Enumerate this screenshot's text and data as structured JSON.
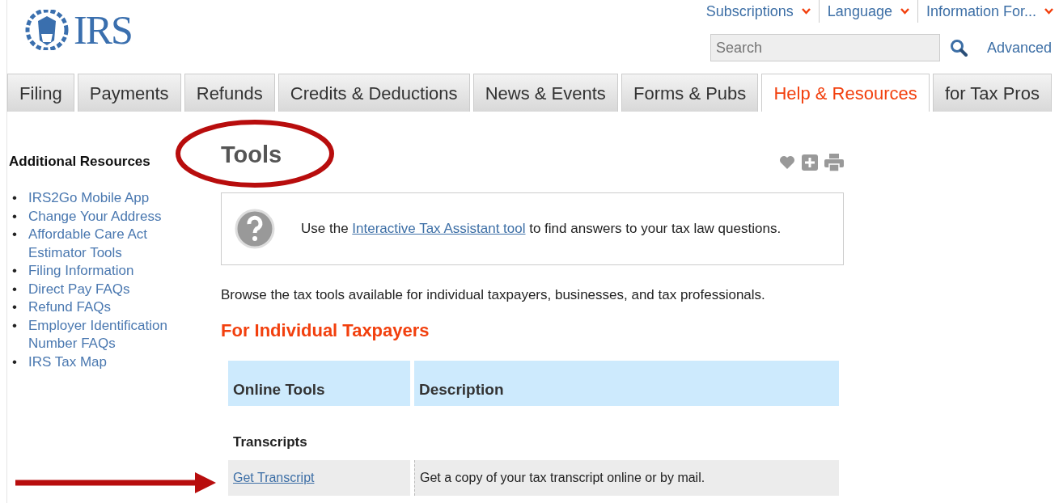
{
  "header": {
    "logo_text": "IRS",
    "top_links": [
      {
        "label": "Subscriptions"
      },
      {
        "label": "Language"
      },
      {
        "label": "Information For..."
      }
    ],
    "search": {
      "placeholder": "Search"
    },
    "advanced_link": "Advanced"
  },
  "tabs": [
    {
      "label": "Filing",
      "selected": false
    },
    {
      "label": "Payments",
      "selected": false
    },
    {
      "label": "Refunds",
      "selected": false
    },
    {
      "label": "Credits & Deductions",
      "selected": false
    },
    {
      "label": "News & Events",
      "selected": false
    },
    {
      "label": "Forms & Pubs",
      "selected": false
    },
    {
      "label": "Help & Resources",
      "selected": true
    },
    {
      "label": "for Tax Pros",
      "selected": false
    }
  ],
  "sidebar": {
    "title": "Additional Resources",
    "items": [
      {
        "bullet": "•",
        "label": "IRS2Go Mobile App"
      },
      {
        "bullet": "•",
        "label": "Change Your Address"
      },
      {
        "bullet": "•",
        "label": "Affordable Care Act Estimator Tools"
      },
      {
        "bullet": "•",
        "label": "Filing Information"
      },
      {
        "bullet": "•",
        "label": "Direct Pay FAQs"
      },
      {
        "bullet": "•",
        "label": "Refund FAQs"
      },
      {
        "bullet": "•",
        "label": "Employer Identification Number FAQs"
      },
      {
        "bullet": "•",
        "label": "IRS Tax Map"
      }
    ]
  },
  "main": {
    "title": "Tools",
    "tip": {
      "before": "Use the",
      "link": "Interactive Tax Assistant tool",
      "after": "to find answers to your tax law questions."
    },
    "intro": "Browse the tax tools available for individual taxpayers, businesses, and tax professionals.",
    "section_heading": "For Individual Taxpayers",
    "table": {
      "columns": [
        "Online Tools",
        "Description"
      ],
      "groups": [
        {
          "title": "Transcripts",
          "rows": [
            {
              "tool": "Get Transcript",
              "description": "Get a copy of your tax transcript online or by mail."
            }
          ]
        }
      ]
    }
  }
}
